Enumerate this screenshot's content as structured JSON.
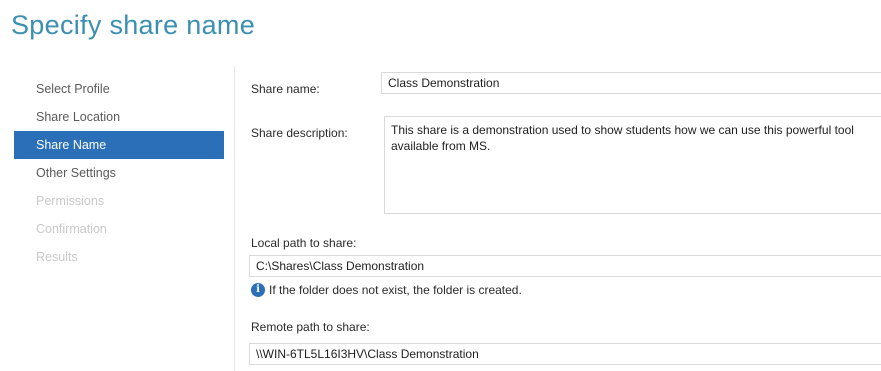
{
  "page": {
    "title": "Specify share name"
  },
  "nav": {
    "items": [
      {
        "label": "Select Profile",
        "state": "enabled"
      },
      {
        "label": "Share Location",
        "state": "enabled"
      },
      {
        "label": "Share Name",
        "state": "active"
      },
      {
        "label": "Other Settings",
        "state": "enabled"
      },
      {
        "label": "Permissions",
        "state": "disabled"
      },
      {
        "label": "Confirmation",
        "state": "disabled"
      },
      {
        "label": "Results",
        "state": "disabled"
      }
    ]
  },
  "form": {
    "share_name_label": "Share name:",
    "share_name_value": "Class Demonstration",
    "share_description_label": "Share description:",
    "share_description_value": "This share is a demonstration used to show students how we can use this powerful tool available from MS.",
    "local_path_label": "Local path to share:",
    "local_path_value": "C:\\Shares\\Class Demonstration",
    "info_text": "If the folder does not exist, the folder is created.",
    "remote_path_label": "Remote path to share:",
    "remote_path_value": "\\\\WIN-6TL5L16I3HV\\Class Demonstration"
  },
  "icons": {
    "info": "info-icon"
  },
  "colors": {
    "title": "#3b8fb0",
    "nav_active_bg": "#2a6fb8",
    "nav_disabled_text": "#c9c9c9"
  }
}
